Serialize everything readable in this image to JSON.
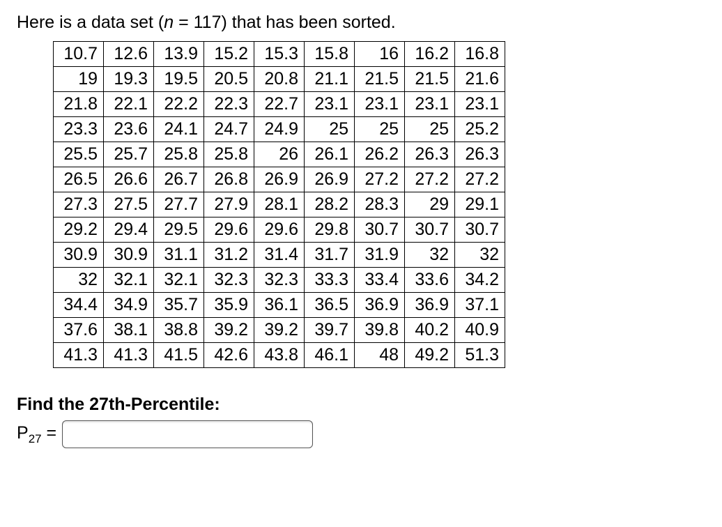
{
  "intro": {
    "prefix": "Here is a data set (",
    "n_var": "n",
    "equals": " = ",
    "n_value": "117",
    "suffix": ") that has been sorted."
  },
  "table": {
    "rows": [
      [
        "10.7",
        "12.6",
        "13.9",
        "15.2",
        "15.3",
        "15.8",
        "16",
        "16.2",
        "16.8"
      ],
      [
        "19",
        "19.3",
        "19.5",
        "20.5",
        "20.8",
        "21.1",
        "21.5",
        "21.5",
        "21.6"
      ],
      [
        "21.8",
        "22.1",
        "22.2",
        "22.3",
        "22.7",
        "23.1",
        "23.1",
        "23.1",
        "23.1"
      ],
      [
        "23.3",
        "23.6",
        "24.1",
        "24.7",
        "24.9",
        "25",
        "25",
        "25",
        "25.2"
      ],
      [
        "25.5",
        "25.7",
        "25.8",
        "25.8",
        "26",
        "26.1",
        "26.2",
        "26.3",
        "26.3"
      ],
      [
        "26.5",
        "26.6",
        "26.7",
        "26.8",
        "26.9",
        "26.9",
        "27.2",
        "27.2",
        "27.2"
      ],
      [
        "27.3",
        "27.5",
        "27.7",
        "27.9",
        "28.1",
        "28.2",
        "28.3",
        "29",
        "29.1"
      ],
      [
        "29.2",
        "29.4",
        "29.5",
        "29.6",
        "29.6",
        "29.8",
        "30.7",
        "30.7",
        "30.7"
      ],
      [
        "30.9",
        "30.9",
        "31.1",
        "31.2",
        "31.4",
        "31.7",
        "31.9",
        "32",
        "32"
      ],
      [
        "32",
        "32.1",
        "32.1",
        "32.3",
        "32.3",
        "33.3",
        "33.4",
        "33.6",
        "34.2"
      ],
      [
        "34.4",
        "34.9",
        "35.7",
        "35.9",
        "36.1",
        "36.5",
        "36.9",
        "36.9",
        "37.1"
      ],
      [
        "37.6",
        "38.1",
        "38.8",
        "39.2",
        "39.2",
        "39.7",
        "39.8",
        "40.2",
        "40.9"
      ],
      [
        "41.3",
        "41.3",
        "41.5",
        "42.6",
        "43.8",
        "46.1",
        "48",
        "49.2",
        "51.3"
      ]
    ]
  },
  "question": "Find the 27th-Percentile:",
  "answer": {
    "symbol": "P",
    "subscript": "27",
    "equals": " = ",
    "value": ""
  }
}
